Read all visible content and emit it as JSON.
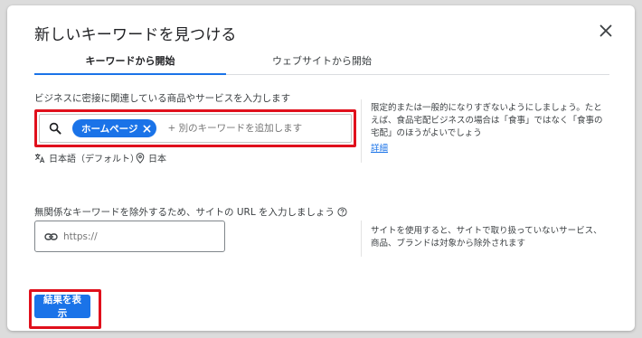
{
  "dialog": {
    "title": "新しいキーワードを見つける",
    "close_icon": "close-icon"
  },
  "tabs": [
    {
      "label": "キーワードから開始",
      "active": true
    },
    {
      "label": "ウェブサイトから開始",
      "active": false
    }
  ],
  "keywords": {
    "label": "ビジネスに密接に関連している商品やサービスを入力します",
    "chips": [
      "ホームページ"
    ],
    "placeholder": "+ 別のキーワードを追加します",
    "language": "日本語（デフォルト）",
    "location": "日本",
    "help_text": "限定的または一般的になりすぎないようにしましょう。たとえば、食品宅配ビジネスの場合は「食事」ではなく「食事の宅配」のほうがよいでしょう",
    "help_link": "詳細"
  },
  "site": {
    "label": "無関係なキーワードを除外するため、サイトの URL を入力しましょう",
    "placeholder": "https://",
    "help_text": "サイトを使用すると、サイトで取り扱っていないサービス、商品、ブランドは対象から除外されます"
  },
  "actions": {
    "submit_label": "結果を表示"
  },
  "colors": {
    "accent": "#1a73e8",
    "highlight": "#e0101c"
  }
}
